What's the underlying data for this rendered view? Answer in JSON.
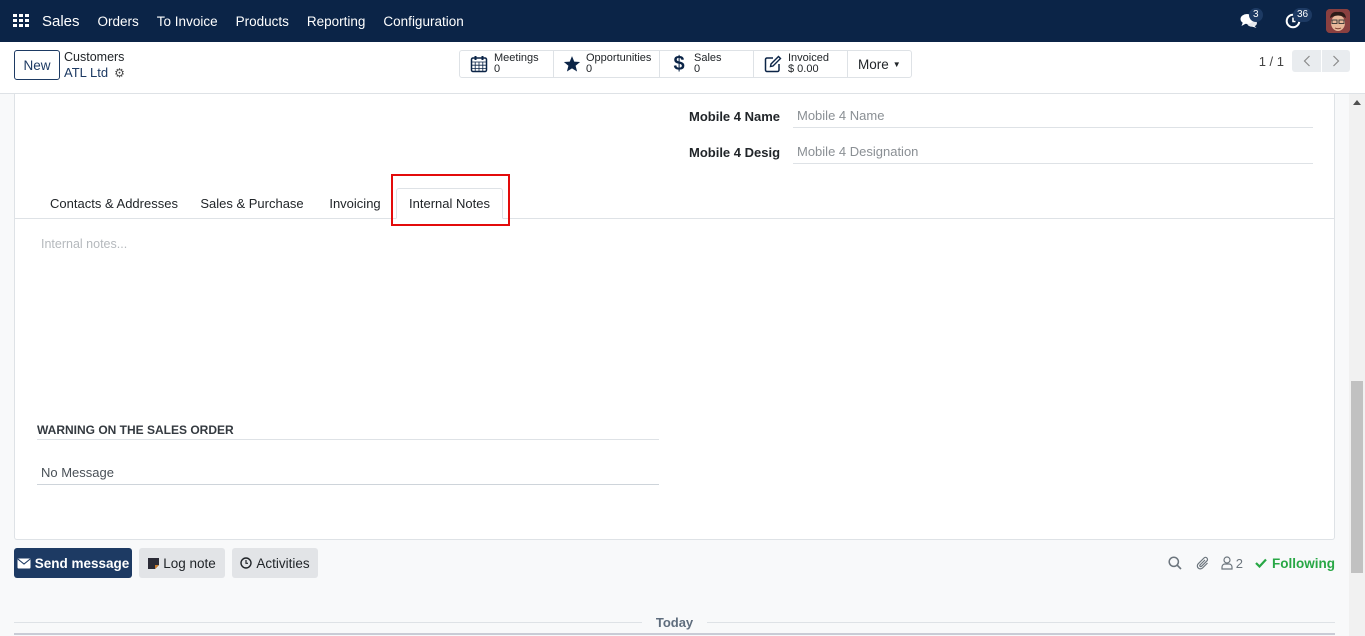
{
  "navbar": {
    "app_name": "Sales",
    "menu": [
      "Orders",
      "To Invoice",
      "Products",
      "Reporting",
      "Configuration"
    ],
    "messages_count": "3",
    "activities_count": "36",
    "bg_color": "#0b2447"
  },
  "control_panel": {
    "new_label": "New",
    "breadcrumb": "Customers",
    "record_name": "ATL Ltd",
    "smart_buttons": [
      {
        "icon": "calendar-icon",
        "label": "Meetings",
        "value": "0"
      },
      {
        "icon": "star-icon",
        "label": "Opportunities",
        "value": "0"
      },
      {
        "icon": "dollar-icon",
        "label": "Sales",
        "value": "0"
      },
      {
        "icon": "edit-icon",
        "label": "Invoiced",
        "value": "$ 0.00"
      }
    ],
    "more_label": "More",
    "pager": "1 / 1"
  },
  "form": {
    "fields": [
      {
        "label": "Mobile 4 Name",
        "placeholder": "Mobile 4 Name",
        "value": ""
      },
      {
        "label": "Mobile 4 Desig",
        "placeholder": "Mobile 4 Designation",
        "value": ""
      }
    ],
    "tabs": [
      "Contacts & Addresses",
      "Sales & Purchase",
      "Invoicing",
      "Internal Notes"
    ],
    "active_tab": "Internal Notes",
    "internal_notes_placeholder": "Internal notes...",
    "warning_title": "WARNING ON THE SALES ORDER",
    "warning_value": "No Message"
  },
  "chatter": {
    "send_message": "Send message",
    "log_note": "Log note",
    "activities": "Activities",
    "followers_count": "2",
    "following_label": "Following",
    "today_label": "Today",
    "following_color": "#28a745"
  },
  "highlight_color": "#e30b0b"
}
